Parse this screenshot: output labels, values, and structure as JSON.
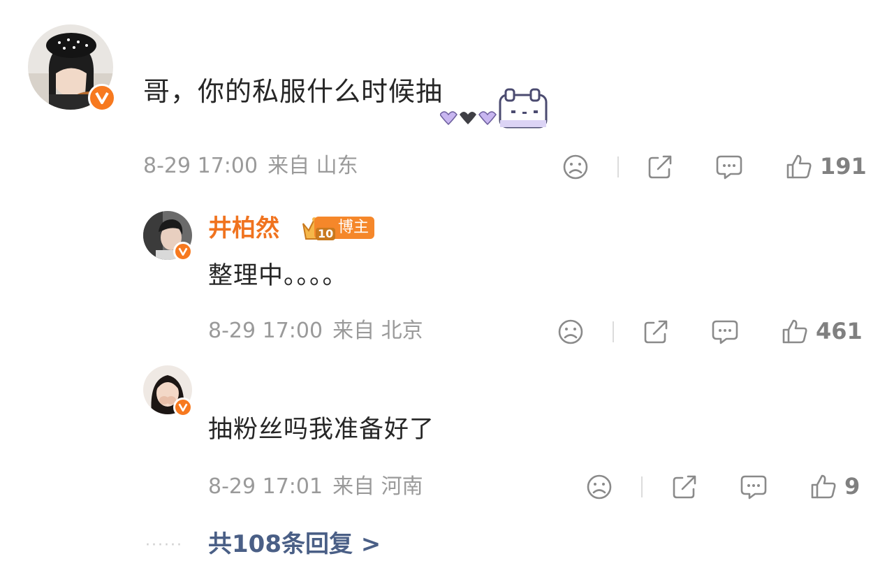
{
  "main_comment": {
    "text": "哥，你的私服什么时候抽",
    "date": "8-29 17:00",
    "source": "来自 山东",
    "like_count": "191"
  },
  "replies": [
    {
      "username": "井柏然",
      "role_badge": "博主",
      "level_badge": "10",
      "text": "整理中。。。。",
      "date": "8-29 17:00",
      "source": "来自 北京",
      "like_count": "461"
    },
    {
      "text": "抽粉丝吗我准备好了",
      "date": "8-29 17:01",
      "source": "来自 河南",
      "like_count": "9"
    }
  ],
  "footer": {
    "dots": "······",
    "more_replies_label": "共108条回复 >"
  },
  "colors": {
    "accent_orange": "#f0731f",
    "link_blue": "#4a5f86",
    "meta_gray": "#9a9a9a"
  },
  "icons": [
    "sad-face-icon",
    "share-icon",
    "comment-icon",
    "thumbs-up-icon",
    "verified-badge-icon",
    "crown-icon",
    "bunny-sticker-icon"
  ]
}
